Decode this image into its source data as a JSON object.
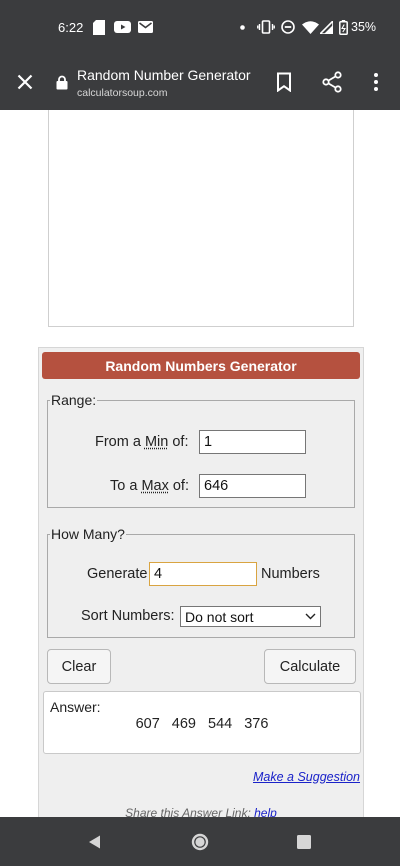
{
  "status_bar": {
    "time": "6:22",
    "battery": "35%",
    "icons": [
      "sd-card-icon",
      "youtube-icon",
      "gmail-icon",
      "dot-icon",
      "vibrate-icon",
      "dnd-icon",
      "wifi-icon",
      "signal-icon",
      "battery-icon"
    ]
  },
  "browser": {
    "page_title": "Random Number Generator",
    "url": "calculatorsoup.com"
  },
  "calculator": {
    "header": "Random Numbers Generator",
    "range": {
      "legend": "Range:",
      "min_label_prefix": "From a ",
      "min_label_abbr": "Min",
      "min_label_suffix": " of:",
      "min_value": "1",
      "max_label_prefix": "To a ",
      "max_label_abbr": "Max",
      "max_label_suffix": " of:",
      "max_value": "646"
    },
    "how_many": {
      "legend": "How Many?",
      "generate_label": "Generate",
      "count_value": "4",
      "numbers_label": "Numbers",
      "sort_label": "Sort Numbers:",
      "sort_selected": "Do not sort"
    },
    "buttons": {
      "clear": "Clear",
      "calculate": "Calculate"
    },
    "answer": {
      "label": "Answer:",
      "values": [
        "607",
        "469",
        "544",
        "376"
      ]
    },
    "suggestion_link": "Make a Suggestion",
    "share_text": "Share this Answer Link: ",
    "share_help": "help"
  },
  "colors": {
    "system_bar": "#3b3c3e",
    "header_accent": "#b5513f",
    "link": "#1a22c9",
    "focus_border": "#d9a441"
  }
}
